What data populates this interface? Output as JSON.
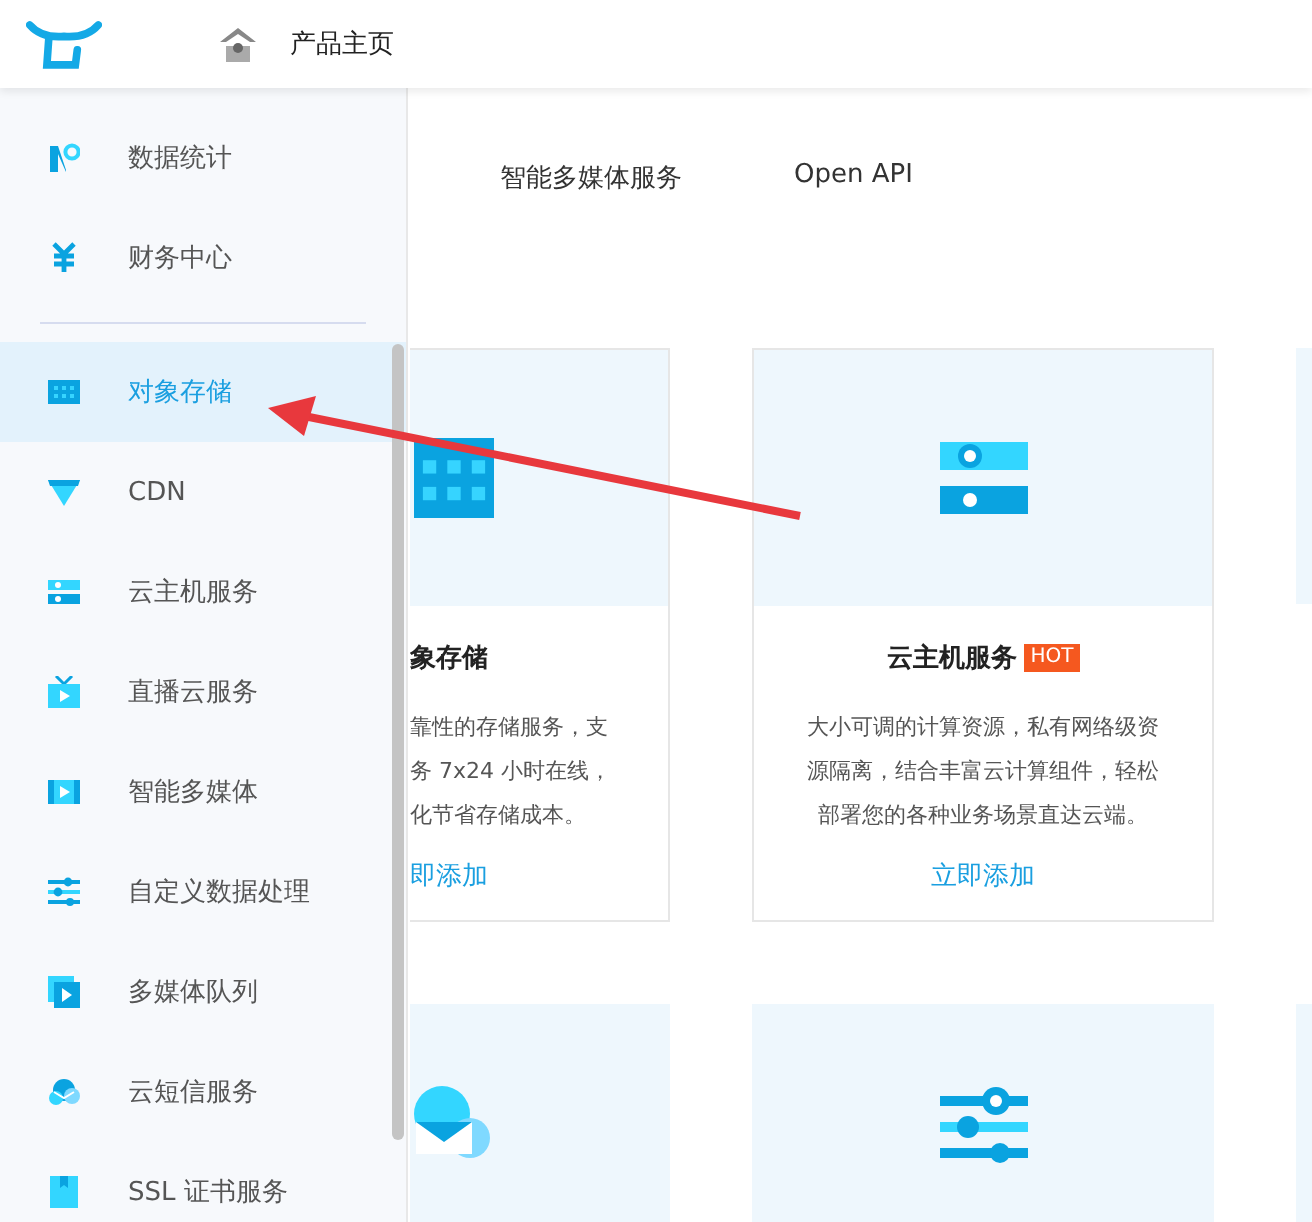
{
  "header": {
    "title": "产品主页"
  },
  "sidebar": {
    "top_items": [
      {
        "label": "数据统计",
        "selected": false
      },
      {
        "label": "财务中心",
        "selected": false
      }
    ],
    "items": [
      {
        "label": "对象存储",
        "selected": true
      },
      {
        "label": "CDN",
        "selected": false
      },
      {
        "label": "云主机服务",
        "selected": false
      },
      {
        "label": "直播云服务",
        "selected": false
      },
      {
        "label": "智能多媒体",
        "selected": false
      },
      {
        "label": "自定义数据处理",
        "selected": false
      },
      {
        "label": "多媒体队列",
        "selected": false
      },
      {
        "label": "云短信服务",
        "selected": false
      },
      {
        "label": "SSL 证书服务",
        "selected": false
      }
    ]
  },
  "tabs": [
    {
      "label": "智能多媒体服务"
    },
    {
      "label": "Open API"
    }
  ],
  "cards": [
    {
      "title": "象存储",
      "lines": [
        "靠性的存储服务，支",
        "务 7x24 小时在线，",
        "化节省存储成本。"
      ],
      "link": "即添加"
    },
    {
      "title": "云主机服务",
      "badge": "HOT",
      "lines": [
        "大小可调的计算资源，私有网络级资",
        "源隔离，结合丰富云计算组件，轻松",
        "部署您的各种业务场景直达云端。"
      ],
      "link": "立即添加"
    }
  ]
}
